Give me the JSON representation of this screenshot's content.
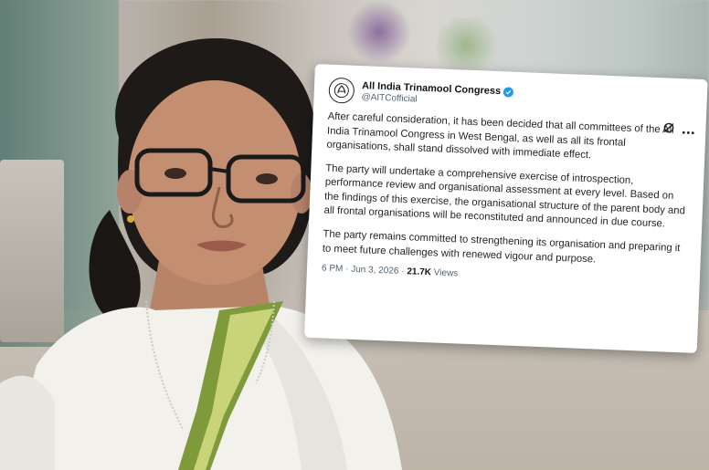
{
  "tweet": {
    "account_name": "All India Trinamool Congress",
    "handle": "@AITCofficial",
    "paragraphs": [
      "After careful consideration, it has been decided that all committees of the All India Trinamool Congress in West Bengal, as well as all its frontal organisations, shall stand dissolved with immediate effect.",
      "The party will undertake a comprehensive exercise of introspection, performance review and organisational assessment at every level. Based on the findings of this exercise, the organisational structure of the parent body and all frontal organisations will be reconstituted and announced in due course.",
      "The party remains committed to strengthening its organisation and preparing it to meet future challenges with renewed vigour and purpose."
    ],
    "timestamp": "6 PM · Jun 3, 2026 ·",
    "views_count": "21.7K",
    "views_label": "Views",
    "icons": {
      "avatar": "party-logo-icon",
      "verified": "verified-badge-icon",
      "grok": "grok-icon",
      "more": "more-options-icon"
    },
    "colors": {
      "verified": "#1d9bf0",
      "text": "#1f2328",
      "muted": "#536471"
    }
  },
  "photo": {
    "subject": "woman in white sari with green border"
  }
}
